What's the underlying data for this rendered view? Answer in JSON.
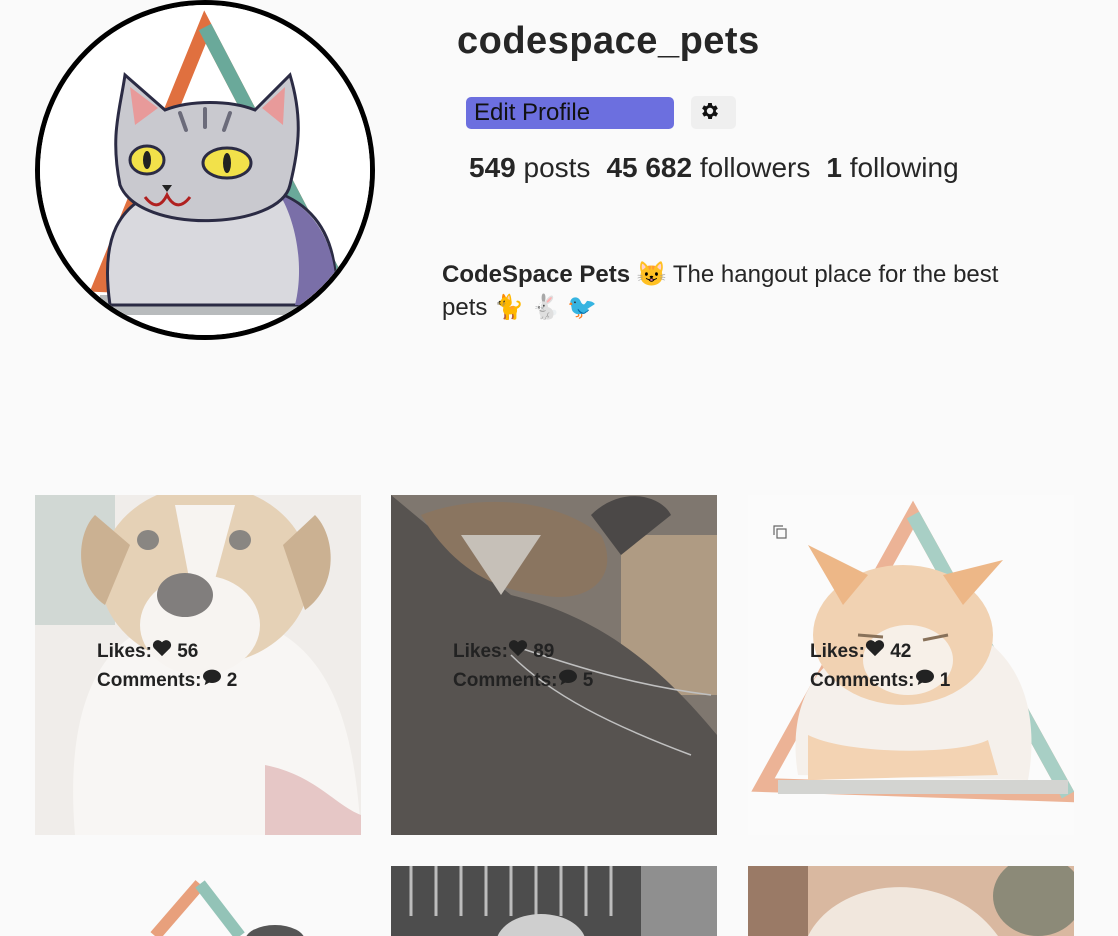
{
  "profile": {
    "username": "codespace_pets",
    "edit_label": "Edit Profile",
    "posts_count": "549",
    "posts_label": "posts",
    "followers_count": "45 682",
    "followers_label": "followers",
    "following_count": "1",
    "following_label": "following",
    "bio_name": "CodeSpace Pets",
    "bio_text_1": "The hangout place for the best",
    "bio_text_2": "pets",
    "bio_emoji_1": "😺",
    "bio_emoji_2": "🐈",
    "bio_emoji_3": "🐇",
    "bio_emoji_4": "🐦"
  },
  "labels": {
    "likes": "Likes:",
    "comments": "Comments:"
  },
  "posts": [
    {
      "likes": "56",
      "comments": "2",
      "subject": "dog"
    },
    {
      "likes": "89",
      "comments": "5",
      "subject": "calico-cat"
    },
    {
      "likes": "42",
      "comments": "1",
      "subject": "orange-cat",
      "multi": true
    }
  ],
  "colors": {
    "accent": "#6c6fdf",
    "background": "#fafafa",
    "triangle_orange": "#e0703f",
    "triangle_teal": "#6aa99a"
  },
  "icons": {
    "settings": "gear-icon",
    "like": "heart-icon",
    "comment": "comment-icon",
    "multi": "multiple-photos-icon"
  }
}
